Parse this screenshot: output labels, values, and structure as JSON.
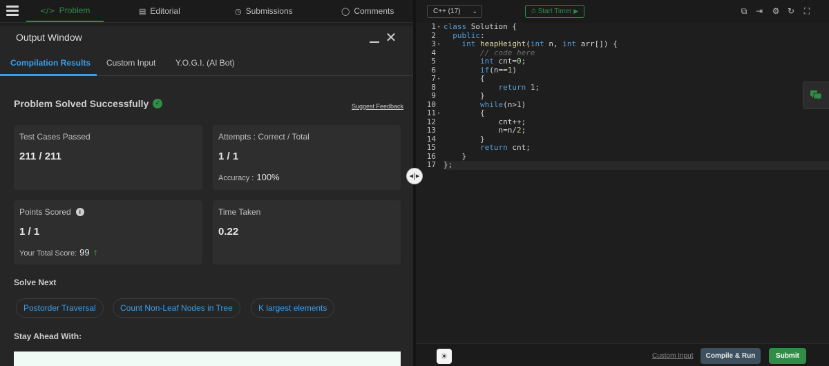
{
  "nav": {
    "tabs": [
      {
        "label": "Problem",
        "icon": "code-icon",
        "glyph": "</>"
      },
      {
        "label": "Editorial",
        "icon": "document-icon",
        "glyph": "▤"
      },
      {
        "label": "Submissions",
        "icon": "clock-icon",
        "glyph": "◷"
      },
      {
        "label": "Comments",
        "icon": "comment-icon",
        "glyph": "◯"
      }
    ],
    "accent": "#2f8d46"
  },
  "output": {
    "title": "Output Window",
    "close_glyph": "✕",
    "tabs": [
      "Compilation Results",
      "Custom Input",
      "Y.O.G.I. (AI Bot)"
    ],
    "status": "Problem Solved Successfully",
    "status_check": "✓",
    "feedback_link": "Suggest Feedback",
    "cards": {
      "tests": {
        "label": "Test Cases Passed",
        "value": "211 / 211"
      },
      "attempts": {
        "label": "Attempts : Correct / Total",
        "value": "1 / 1",
        "sub_label": "Accuracy :",
        "sub_value": "100%"
      },
      "points": {
        "label": "Points Scored",
        "info": "i",
        "value": "1 / 1",
        "sub_label": "Your Total Score:",
        "sub_value": "99",
        "arrow": "↑"
      },
      "time": {
        "label": "Time Taken",
        "value": "0.22"
      }
    },
    "solve_next_title": "Solve Next",
    "solve_next": [
      "Postorder Traversal",
      "Count Non-Leaf Nodes in Tree",
      "K largest elements"
    ],
    "stay_ahead_title": "Stay Ahead With:"
  },
  "splitter_glyph": "◂|▸",
  "editor": {
    "language": "C++ (17)",
    "language_caret": "⌄",
    "timer_label": "Start Timer",
    "timer_icon_glyph": "⏱",
    "timer_play_glyph": "▶",
    "toolbar_icons": [
      {
        "name": "copy-icon",
        "glyph": "⧉"
      },
      {
        "name": "exit-icon",
        "glyph": "⇥"
      },
      {
        "name": "settings-icon",
        "glyph": "⚙"
      },
      {
        "name": "reset-icon",
        "glyph": "↻"
      },
      {
        "name": "fullscreen-icon",
        "glyph": "⛶"
      }
    ],
    "code_lines": [
      "class Solution {",
      "  public:",
      "    int heapHeight(int n, int arr[]) {",
      "        // code here",
      "        int cnt=0;",
      "        if(n==1)",
      "        {",
      "            return 1;",
      "        }",
      "        while(n>1)",
      "        {",
      "            cnt++;",
      "            n=n/2;",
      "        }",
      "        return cnt;",
      "    }",
      "};"
    ],
    "fold_lines": [
      1,
      3,
      7,
      11
    ]
  },
  "footer": {
    "theme_glyph": "☀",
    "custom_input": "Custom Input",
    "compile_run": "Compile & Run",
    "submit": "Submit"
  }
}
